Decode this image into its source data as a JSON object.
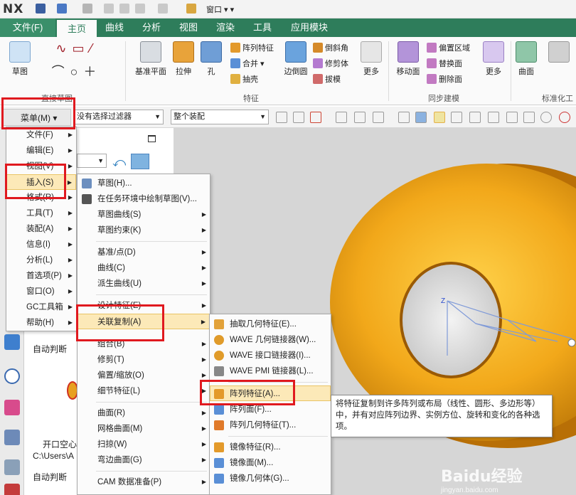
{
  "app": {
    "logo": "NX",
    "window_menu": "窗口"
  },
  "tabs": [
    "文件(F)",
    "主页",
    "曲线",
    "分析",
    "视图",
    "渲染",
    "工具",
    "应用模块"
  ],
  "ribbon": {
    "sketch": "草图",
    "direct_sketch_group": "直接草图",
    "datum_plane": "基准平面",
    "extrude": "拉伸",
    "hole": "孔",
    "pattern_feature": "阵列特征",
    "unite": "合并",
    "shell": "抽壳",
    "edge_blend": "边倒圆",
    "chamfer": "倒斜角",
    "trim_body": "修剪体",
    "draft": "拔模",
    "more_1": "更多",
    "feature_group": "特征",
    "move_face": "移动面",
    "offset_region": "偏置区域",
    "replace_face": "替换面",
    "delete_face": "删除面",
    "more_2": "更多",
    "sync_group": "同步建模",
    "surface": "曲面",
    "std_group": "标准化工"
  },
  "toolbar": {
    "menu_button": "菜单(M)",
    "filter": "没有选择过滤器",
    "scope": "整个装配"
  },
  "main_menu": [
    {
      "label": "文件(F)"
    },
    {
      "label": "编辑(E)"
    },
    {
      "label": "视图(V)"
    },
    {
      "label": "插入(S)"
    },
    {
      "label": "格式(R)"
    },
    {
      "label": "工具(T)"
    },
    {
      "label": "装配(A)"
    },
    {
      "label": "信息(I)"
    },
    {
      "label": "分析(L)"
    },
    {
      "label": "首选项(P)"
    },
    {
      "label": "窗口(O)"
    },
    {
      "label": "GC工具箱"
    },
    {
      "label": "帮助(H)"
    }
  ],
  "insert_menu": [
    {
      "label": "草图(H)..."
    },
    {
      "label": "在任务环境中绘制草图(V)..."
    },
    {
      "label": "草图曲线(S)"
    },
    {
      "label": "草图约束(K)"
    },
    {
      "label": "基准/点(D)"
    },
    {
      "label": "曲线(C)"
    },
    {
      "label": "派生曲线(U)"
    },
    {
      "label": "设计特征(E)"
    },
    {
      "label": "关联复制(A)"
    },
    {
      "label": "组合(B)"
    },
    {
      "label": "修剪(T)"
    },
    {
      "label": "偏置/缩放(O)"
    },
    {
      "label": "细节特征(L)"
    },
    {
      "label": "曲面(R)"
    },
    {
      "label": "网格曲面(M)"
    },
    {
      "label": "扫掠(W)"
    },
    {
      "label": "弯边曲面(G)"
    },
    {
      "label": "CAM 数据准备(P)"
    }
  ],
  "assoc_copy_menu": [
    {
      "label": "抽取几何特征(E)..."
    },
    {
      "label": "WAVE 几何链接器(W)..."
    },
    {
      "label": "WAVE 接口链接器(I)..."
    },
    {
      "label": "WAVE PMI 链接器(L)..."
    },
    {
      "label": "阵列特征(A)..."
    },
    {
      "label": "阵列面(F)..."
    },
    {
      "label": "阵列几何特征(T)..."
    },
    {
      "label": "镜像特征(R)..."
    },
    {
      "label": "镜像面(M)..."
    },
    {
      "label": "镜像几何体(G)..."
    }
  ],
  "tooltip": "将特征复制到许多阵列或布局（线性、圆形、多边形等）中，并有对应阵列边界、实例方位、旋转和变化的各种选项。",
  "panel": {
    "auto_infer_1": "自动判断",
    "file_name": "开口空心",
    "path": "C:\\Users\\A",
    "auto_infer_2": "自动判断"
  },
  "watermark": {
    "brand": "Baidu经验",
    "url": "jingyan.baidu.com"
  }
}
